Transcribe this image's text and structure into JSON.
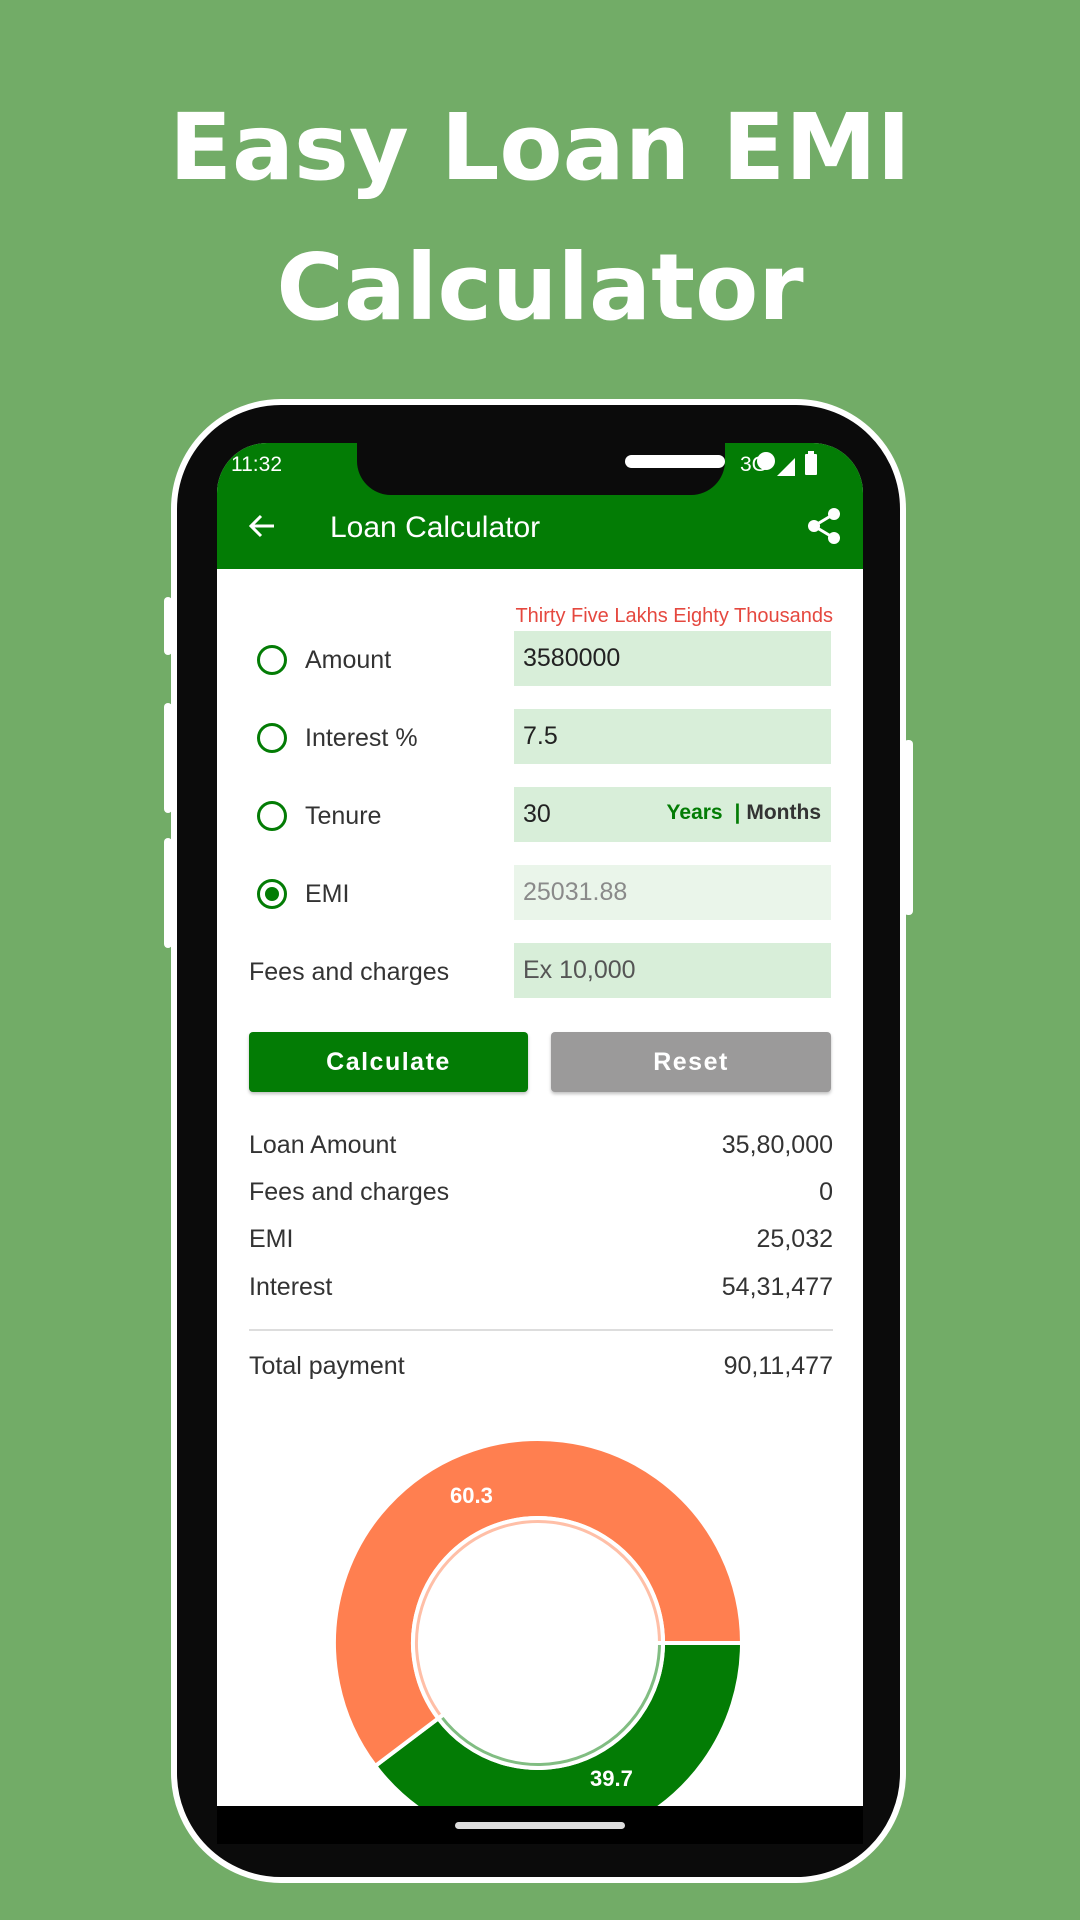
{
  "promo": {
    "title_line1": "Easy Loan EMI",
    "title_line2": "Calculator"
  },
  "status_bar": {
    "time": "11:32",
    "network": "3G"
  },
  "appbar": {
    "title": "Loan Calculator",
    "back_icon": "arrow-left-icon",
    "share_icon": "share-icon"
  },
  "form": {
    "amount_words": "Thirty Five Lakhs Eighty Thousands",
    "rows": [
      {
        "label": "Amount",
        "value": "3580000",
        "selected": false
      },
      {
        "label": "Interest %",
        "value": "7.5",
        "selected": false
      },
      {
        "label": "Tenure",
        "value": "30",
        "selected": false,
        "unit_years": "Years",
        "unit_separator": "|",
        "unit_months": "Months"
      },
      {
        "label": "EMI",
        "value": "25031.88",
        "selected": true
      }
    ],
    "fees_label": "Fees and charges",
    "fees_placeholder": "Ex 10,000"
  },
  "buttons": {
    "calculate": "Calculate",
    "reset": "Reset"
  },
  "summary": [
    {
      "label": "Loan Amount",
      "value": "35,80,000"
    },
    {
      "label": "Fees and charges",
      "value": "0"
    },
    {
      "label": "EMI",
      "value": "25,032"
    },
    {
      "label": "Interest",
      "value": "54,31,477"
    }
  ],
  "total": {
    "label": "Total payment",
    "value": "90,11,477"
  },
  "colors": {
    "primary": "#037c05",
    "interest": "#ff7f50",
    "principal": "#037c05",
    "background": "#72ac67"
  },
  "chart_data": {
    "type": "pie",
    "donut": true,
    "values": [
      39.7,
      60.3
    ],
    "labels": [
      "39.7",
      "60.3"
    ],
    "colors": [
      "#037c05",
      "#ff7f50"
    ]
  }
}
